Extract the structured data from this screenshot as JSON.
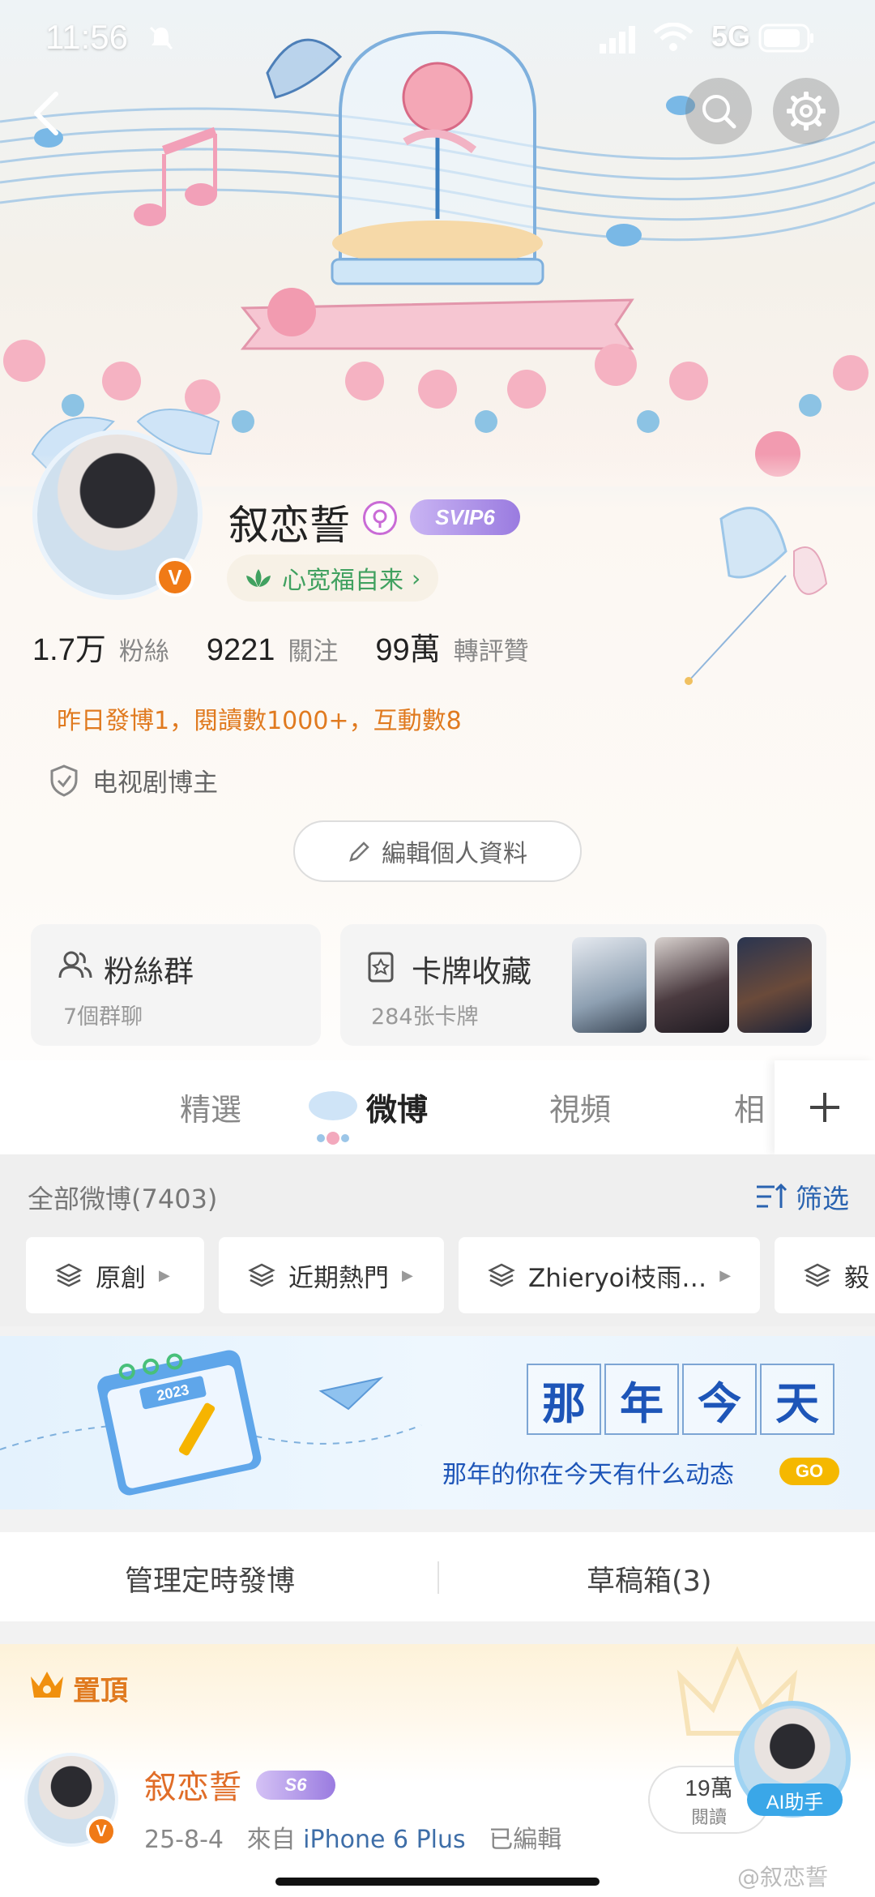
{
  "status": {
    "time": "11:56",
    "network": "5G"
  },
  "header": {
    "back_icon": "back-arrow-icon",
    "search_icon": "search-icon",
    "settings_icon": "gear-icon"
  },
  "profile": {
    "name": "叙恋誓",
    "svip": "SVIP6",
    "verified": "V",
    "motto": "心宽福自来",
    "stats": [
      {
        "num": "1.7万",
        "label": "粉絲"
      },
      {
        "num": "9221",
        "label": "關注"
      },
      {
        "num": "99萬",
        "label": "轉評贊"
      }
    ],
    "activity": "昨日發博1，閱讀數1000+，互動數8",
    "verify": "电视剧博主",
    "edit_label": "編輯個人資料"
  },
  "cards": {
    "fans_title": "粉絲群",
    "fans_sub": "7個群聊",
    "cards_title": "卡牌收藏",
    "cards_sub": "284张卡牌"
  },
  "tabs": [
    {
      "label": "精選"
    },
    {
      "label": "微博"
    },
    {
      "label": "視頻"
    },
    {
      "label": "相"
    }
  ],
  "filter": {
    "all": "全部微博(7403)",
    "filter_label": "筛选"
  },
  "chips": [
    "原創",
    "近期熱門",
    "Zhieryoi枝雨…",
    "毅"
  ],
  "banner": {
    "chars": [
      "那",
      "年",
      "今",
      "天"
    ],
    "subtitle": "那年的你在今天有什么动态",
    "go": "GO",
    "calendar_year": "2023"
  },
  "manage": {
    "scheduled": "管理定時發博",
    "drafts": "草稿箱(3)"
  },
  "pinned": {
    "label": "置頂",
    "user": "叙恋誓",
    "level": "S6",
    "meta_date": "25-8-4",
    "meta_from": "來自",
    "meta_device": "iPhone 6 Plus",
    "meta_edited": "已編輯",
    "reads_num": "19萬",
    "reads_label": "閱讀",
    "ai_label": "AI助手"
  },
  "watermark": "@叙恋誓",
  "colors": {
    "accent_orange": "#e07a1f",
    "link_blue": "#2a63b0",
    "motto_green": "#41a160",
    "svip_purple": "#9a7be0"
  }
}
